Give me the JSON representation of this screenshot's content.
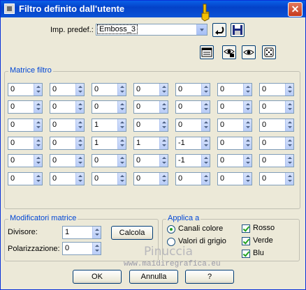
{
  "window": {
    "title": "Filtro definito dall'utente",
    "close_glyph": "✕"
  },
  "preset": {
    "label": "Imp. predef.:",
    "value": "Emboss_3"
  },
  "matrix": {
    "legend": "Matrice filtro",
    "rows": [
      [
        "0",
        "0",
        "0",
        "0",
        "0",
        "0",
        "0"
      ],
      [
        "0",
        "0",
        "0",
        "0",
        "0",
        "0",
        "0"
      ],
      [
        "0",
        "0",
        "1",
        "0",
        "0",
        "0",
        "0"
      ],
      [
        "0",
        "0",
        "1",
        "1",
        "-1",
        "0",
        "0"
      ],
      [
        "0",
        "0",
        "0",
        "0",
        "-1",
        "0",
        "0"
      ],
      [
        "0",
        "0",
        "0",
        "0",
        "0",
        "0",
        "0"
      ]
    ]
  },
  "modifiers": {
    "legend": "Modificatori matrice",
    "divisor_label": "Divisore:",
    "divisor_value": "1",
    "bias_label": "Polarizzazione:",
    "bias_value": "0",
    "calc_label": "Calcola"
  },
  "apply": {
    "legend": "Applica a",
    "color_channels": "Canali colore",
    "grey_values": "Valori di grigio",
    "red": "Rosso",
    "green": "Verde",
    "blue": "Blu"
  },
  "buttons": {
    "ok": "OK",
    "cancel": "Annulla",
    "help": "?"
  },
  "watermark": {
    "name": "Pinuccia",
    "site": "www.maidiregrafica.eu"
  },
  "colors": {
    "title_bar": "#0a5fe8",
    "legend_text": "#0046d5",
    "dialog_bg": "#ece9d8"
  }
}
